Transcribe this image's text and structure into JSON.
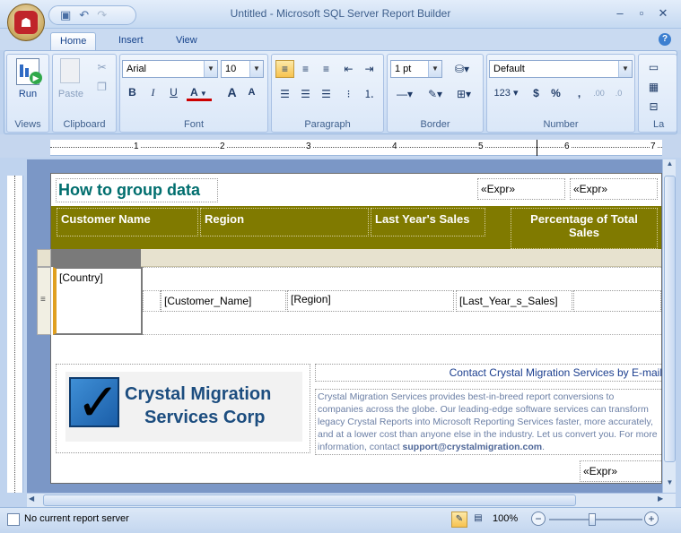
{
  "app": {
    "title": "Untitled - Microsoft SQL Server Report Builder",
    "window_buttons": [
      "–",
      "▫",
      "✕"
    ]
  },
  "qat": {
    "icons": [
      "save-icon",
      "undo-icon",
      "redo-icon"
    ]
  },
  "tabs": [
    {
      "label": "Home",
      "active": true
    },
    {
      "label": "Insert",
      "active": false
    },
    {
      "label": "View",
      "active": false
    }
  ],
  "ribbon": {
    "views": {
      "run_label": "Run",
      "group_label": "Views"
    },
    "clipboard": {
      "paste_label": "Paste",
      "group_label": "Clipboard"
    },
    "font": {
      "family": "Arial",
      "size": "10",
      "group_label": "Font",
      "bold": "B",
      "italic": "I",
      "underline": "U",
      "color": "A",
      "grow": "A",
      "shrink": "A"
    },
    "paragraph": {
      "group_label": "Paragraph"
    },
    "border": {
      "width": "1 pt",
      "group_label": "Border"
    },
    "number": {
      "format": "Default",
      "placeholder": "123",
      "currency": "$",
      "percent": "%",
      "comma": ",",
      "group_label": "Number"
    },
    "layout_label": "La"
  },
  "ruler": {
    "marks": [
      "1",
      "2",
      "3",
      "4",
      "5",
      "6",
      "7"
    ]
  },
  "report": {
    "title": "How to group data",
    "expr1": "«Expr»",
    "expr2": "«Expr»",
    "headers": {
      "customer_name": "Customer Name",
      "region": "Region",
      "last_year_sales": "Last Year's Sales",
      "percentage": "Percentage of Total Sales"
    },
    "group_field": "[Country]",
    "detail": {
      "customer": "[Customer_Name]",
      "region": "[Region]",
      "sales": "[Last_Year_s_Sales]"
    },
    "logo_line1": "Crystal Migration",
    "logo_line2": "Services Corp",
    "contact_heading": "Contact Crystal Migration Services by E-mail",
    "contact_body": "Crystal Migration Services provides best-in-breed report conversions to companies across the globe. Our leading-edge software services can transform legacy Crystal Reports into Microsoft Reporting Services faster, more accurately, and at a lower cost than anyone else in the industry. Let us convert you. For more information, contact ",
    "contact_email": "support@crystalmigration.com",
    "contact_end": ".",
    "footer_expr": "«Expr»"
  },
  "status": {
    "server": "No current report server",
    "zoom": "100%"
  },
  "colors": {
    "header_band": "#807a00",
    "title_text": "#006e6e",
    "ribbon_text": "#15428b",
    "accent": "#f7c24f"
  }
}
